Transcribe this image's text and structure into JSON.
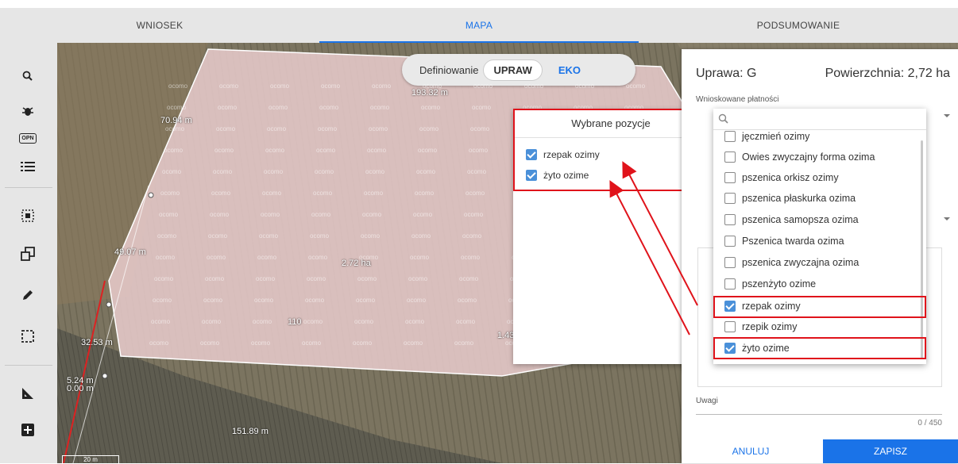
{
  "tabs": [
    {
      "label": "WNIOSEK",
      "active": false
    },
    {
      "label": "MAPA",
      "active": true
    },
    {
      "label": "PODSUMOWANIE",
      "active": false
    }
  ],
  "toolbar": {
    "icons": [
      "search-icon",
      "bug-icon",
      "opn-icon",
      "list-icon",
      "select-area-icon",
      "copy-shape-icon",
      "pencil-icon",
      "rectangle-select-icon",
      "ruler-icon",
      "add-icon"
    ],
    "opn_text": "OPN"
  },
  "map": {
    "measurements": {
      "m1": "193.32 m",
      "m2": "70.94 m",
      "m3": "49.07 m",
      "m4": "32.53 m",
      "m5": "5.24 m",
      "m6": "0.00 m",
      "m7": "151.89 m",
      "area": "2.72 ha",
      "num": "110",
      "m8": "1.43"
    },
    "watermark": "ocomo",
    "scale": "20 m"
  },
  "mode_pill": {
    "label": "Definiowanie",
    "option_active": "UPRAW",
    "option_other": "EKO"
  },
  "selected_popup": {
    "title": "Wybrane pozycje",
    "items": [
      {
        "label": "rzepak ozimy",
        "checked": true
      },
      {
        "label": "żyto ozime",
        "checked": true
      }
    ]
  },
  "panel": {
    "uprawa": "Uprawa: G",
    "powierzchnia": "Powierzchnia: 2,72 ha",
    "platnosci_label": "Wnioskowane płatności",
    "uwagi_label": "Uwagi",
    "counter": "0 / 450",
    "cancel": "ANULUJ",
    "save": "ZAPISZ"
  },
  "dropdown": {
    "search_placeholder": "",
    "options": [
      {
        "label": "jęczmień ozimy",
        "checked": false
      },
      {
        "label": "Owies zwyczajny forma ozima",
        "checked": false
      },
      {
        "label": "pszenica orkisz ozimy",
        "checked": false
      },
      {
        "label": "pszenica płaskurka ozima",
        "checked": false
      },
      {
        "label": "pszenica samopsza ozima",
        "checked": false
      },
      {
        "label": "Pszenica twarda ozima",
        "checked": false
      },
      {
        "label": "pszenica zwyczajna ozima",
        "checked": false
      },
      {
        "label": "pszenżyto ozime",
        "checked": false
      },
      {
        "label": "rzepak ozimy",
        "checked": true
      },
      {
        "label": "rzepik ozimy",
        "checked": false
      },
      {
        "label": "żyto ozime",
        "checked": true
      }
    ]
  },
  "colors": {
    "accent": "#1a73e8",
    "highlight_red": "#e0131b",
    "checkbox_blue": "#4a90d9"
  }
}
